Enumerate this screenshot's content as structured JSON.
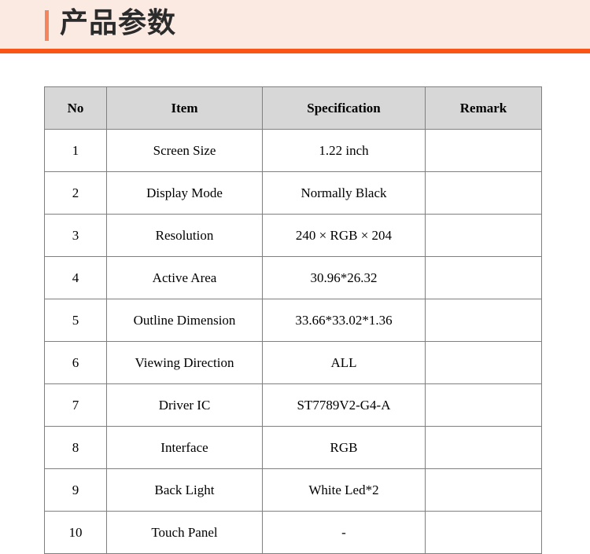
{
  "header": {
    "title": "产品参数",
    "accent_color": "#f5855c",
    "band_color": "#fa5516",
    "background_color": "#faeae2"
  },
  "table": {
    "header_background": "#d7d7d7",
    "border_color": "#7f7f7f",
    "columns": [
      "No",
      "Item",
      "Specification",
      "Remark"
    ],
    "rows": [
      {
        "no": "1",
        "item": "Screen Size",
        "spec": "1.22 inch",
        "remark": ""
      },
      {
        "no": "2",
        "item": "Display Mode",
        "spec": "Normally Black",
        "remark": ""
      },
      {
        "no": "3",
        "item": "Resolution",
        "spec": "240 × RGB × 204",
        "remark": ""
      },
      {
        "no": "4",
        "item": "Active Area",
        "spec": "30.96*26.32",
        "remark": ""
      },
      {
        "no": "5",
        "item": "Outline Dimension",
        "spec": "33.66*33.02*1.36",
        "remark": ""
      },
      {
        "no": "6",
        "item": "Viewing Direction",
        "spec": "ALL",
        "remark": ""
      },
      {
        "no": "7",
        "item": "Driver IC",
        "spec": "ST7789V2-G4-A",
        "remark": ""
      },
      {
        "no": "8",
        "item": "Interface",
        "spec": "RGB",
        "remark": ""
      },
      {
        "no": "9",
        "item": "Back Light",
        "spec": "White Led*2",
        "remark": ""
      },
      {
        "no": "10",
        "item": "Touch Panel",
        "spec": "-",
        "remark": ""
      }
    ]
  }
}
